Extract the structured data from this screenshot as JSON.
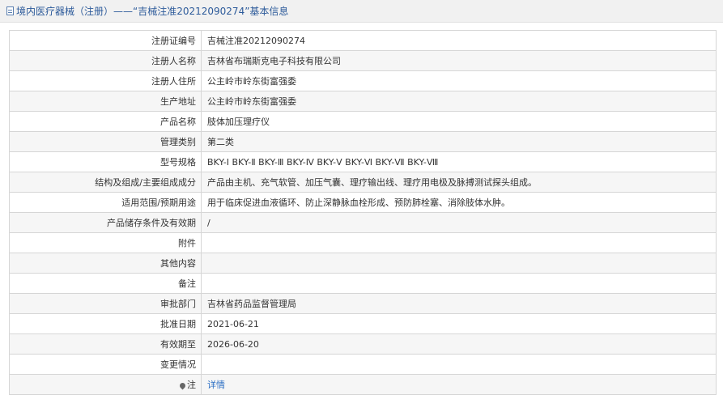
{
  "header": {
    "title": "境内医疗器械（注册）——“吉械注准20212090274”基本信息",
    "icon": "document-icon"
  },
  "rows": [
    {
      "label": "注册证编号",
      "value": "吉械注准20212090274"
    },
    {
      "label": "注册人名称",
      "value": "吉林省布瑞斯克电子科技有限公司"
    },
    {
      "label": "注册人住所",
      "value": "公主岭市岭东街富强委"
    },
    {
      "label": "生产地址",
      "value": "公主岭市岭东街富强委"
    },
    {
      "label": "产品名称",
      "value": "肢体加压理疗仪"
    },
    {
      "label": "管理类别",
      "value": "第二类"
    },
    {
      "label": "型号规格",
      "value": "BKY-Ⅰ BKY-Ⅱ BKY-Ⅲ BKY-Ⅳ BKY-Ⅴ BKY-Ⅵ BKY-Ⅶ BKY-Ⅷ"
    },
    {
      "label": "结构及组成/主要组成成分",
      "value": "产品由主机、充气软管、加压气囊、理疗输出线、理疗用电极及脉搏测试探头组成。"
    },
    {
      "label": "适用范围/预期用途",
      "value": "用于临床促进血液循环、防止深静脉血栓形成、预防肺栓塞、消除肢体水肿。"
    },
    {
      "label": "产品储存条件及有效期",
      "value": "/"
    },
    {
      "label": "附件",
      "value": ""
    },
    {
      "label": "其他内容",
      "value": ""
    },
    {
      "label": "备注",
      "value": ""
    },
    {
      "label": "审批部门",
      "value": "吉林省药品监督管理局"
    },
    {
      "label": "批准日期",
      "value": "2021-06-21"
    },
    {
      "label": "有效期至",
      "value": "2026-06-20"
    },
    {
      "label": "变更情况",
      "value": ""
    }
  ],
  "note_row": {
    "label": "注",
    "icon": "pin-icon",
    "link_text": "详情"
  }
}
